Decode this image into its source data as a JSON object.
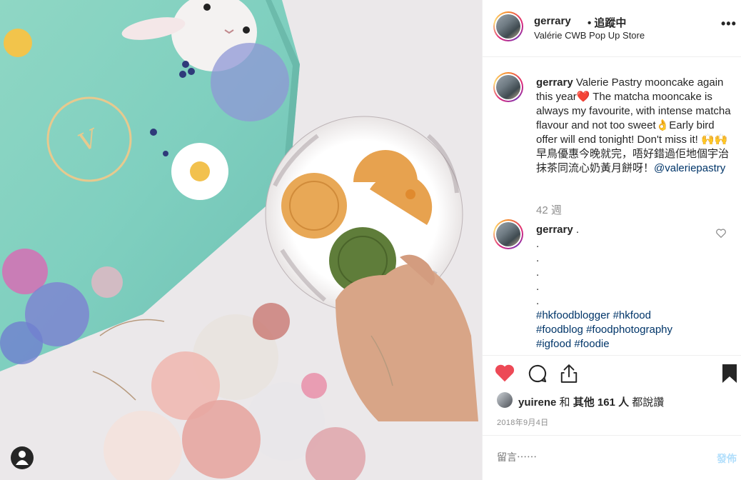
{
  "header": {
    "username": "gerrary",
    "follow_label": "• 追蹤中",
    "location": "Valérie CWB Pop Up Store",
    "more_label": "•••"
  },
  "caption": {
    "username": "gerrary",
    "line1": " Valerie Pastry mooncake again this year❤️ The matcha mooncake is always my favourite, with intense matcha flavour and not too sweet👌Early bird offer will end tonight! Don't miss it! 🙌🙌 早鳥優惠今晚就完，唔好錯過佢地個宇治抹茶同流心奶黃月餅呀！",
    "mention": "@valeriepastry",
    "time_ago": "42 週"
  },
  "comment": {
    "username": "gerrary",
    "dots": [
      ".",
      ".",
      ".",
      ".",
      ".",
      "."
    ],
    "hashtags_line1": "#hkfoodblogger #hkfood",
    "hashtags_line2": "#foodblog #foodphotography",
    "hashtags_line3": "#igfood #foodie"
  },
  "likes": {
    "user": "yuirene",
    "middle": " 和 ",
    "others": "其他 161 人",
    "suffix": " 都說讚"
  },
  "date": "2018年9月4日",
  "add_comment": {
    "placeholder": "留言⋯⋯",
    "post_label": "發佈"
  },
  "colors": {
    "heart": "#ed4956",
    "link": "#003569",
    "muted": "#8e8e8e",
    "post_disabled": "#b2dffc"
  },
  "icons": {
    "like": "heart-filled-icon",
    "comment": "comment-bubble-icon",
    "share": "share-upload-icon",
    "save": "bookmark-filled-icon",
    "user": "user-icon"
  }
}
